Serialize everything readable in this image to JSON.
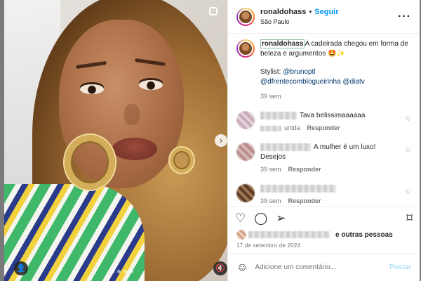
{
  "header": {
    "username": "ronaldohass",
    "separator": "•",
    "follow_label": "Seguir",
    "location": "São Paulo",
    "more_icon": "more-horizontal-icon"
  },
  "caption": {
    "username": "ronaldohass",
    "text": "A cadeirada chegou em forma de beleza e argumentos 🤩✨",
    "stylist_label": "Stylist:",
    "mentions": [
      "@brunoptl",
      "@dfrentecomblogueirinha",
      "@diatv"
    ],
    "time": "39 sem"
  },
  "comments": [
    {
      "text": "Tava belissimaaaaaa",
      "time": "",
      "reply_label": "Responder",
      "time_fragment": "urtida"
    },
    {
      "text": "A mulher é um luxo! Desejos",
      "time": "39 sem",
      "reply_label": "Responder"
    },
    {
      "text": "",
      "time": "39 sem",
      "reply_label": "Responder"
    }
  ],
  "actions": {
    "like_icon": "heart-icon",
    "comment_icon": "comment-icon",
    "share_icon": "send-icon",
    "save_icon": "bookmark-icon"
  },
  "likes": {
    "suffix": "e outras pessoas"
  },
  "date": "17 de setembro de 2024",
  "composer": {
    "placeholder": "Adicione um comentário...",
    "post_label": "Postar",
    "emoji_icon": "emoji-icon"
  },
  "media": {
    "next_icon": "chevron-right-icon",
    "tag_icon": "user-tag-icon",
    "mute_icon": "mute-icon",
    "slide_count": 4,
    "active_slide": 1
  }
}
